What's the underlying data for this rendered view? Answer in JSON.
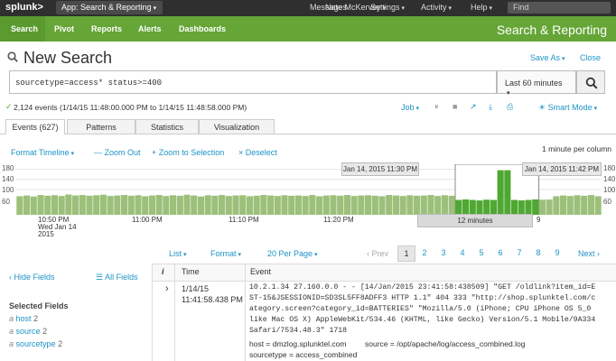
{
  "topbar": {
    "logo": "splunk>",
    "app": "App: Search & Reporting",
    "user": "Nate McKervey",
    "messages": "Messages",
    "settings": "Settings",
    "activity": "Activity",
    "help": "Help",
    "find": "Find"
  },
  "nav": {
    "items": [
      "Search",
      "Pivot",
      "Reports",
      "Alerts",
      "Dashboards"
    ],
    "app_title": "Search & Reporting"
  },
  "search": {
    "title": "New Search",
    "save_as": "Save As",
    "close": "Close",
    "query": "sourcetype=access* status>=400",
    "time_range": "Last 60 minutes"
  },
  "status": {
    "summary": "2,124 events (1/14/15 11:48:00.000 PM to 1/14/15 11:48:58.000 PM)",
    "job": "Job",
    "mode": "Smart Mode"
  },
  "tabs": [
    "Events (627)",
    "Patterns",
    "Statistics",
    "Visualization"
  ],
  "timeline": {
    "format": "Format Timeline",
    "zoom_out": "Zoom Out",
    "zoom_selection": "Zoom to Selection",
    "deselect": "Deselect",
    "scale": "1 minute per column",
    "y_ticks": [
      "180",
      "140",
      "100",
      "60"
    ],
    "y_ticks_right": [
      "180",
      "140",
      "100",
      "60"
    ],
    "tooltip_left": "Jan 14, 2015 11:30 PM",
    "tooltip_right": "Jan 14, 2015 11:42 PM",
    "selection": "12 minutes",
    "x_labels": [
      "10:50 PM",
      "11:00 PM",
      "11:10 PM",
      "11:20 PM"
    ],
    "x_sublabel": [
      "Wed Jan 14",
      "2015"
    ]
  },
  "chart_data": {
    "type": "bar",
    "values": [
      75,
      78,
      74,
      80,
      77,
      79,
      76,
      82,
      78,
      80,
      77,
      79,
      81,
      76,
      78,
      80,
      77,
      79,
      75,
      78,
      80,
      76,
      79,
      77,
      81,
      78,
      74,
      79,
      77,
      80,
      76,
      78,
      79,
      75,
      77,
      80,
      78,
      76,
      79,
      77,
      78,
      76,
      80,
      75,
      78,
      79,
      77,
      80,
      76,
      78,
      79,
      77,
      75,
      80,
      78,
      76,
      79,
      77,
      78,
      80,
      76,
      79,
      77,
      60,
      62,
      60,
      58,
      61,
      60,
      180,
      180,
      60,
      58,
      60,
      62,
      60,
      61,
      75,
      78,
      76,
      79,
      77,
      80,
      75
    ],
    "selected_range": [
      63,
      75
    ],
    "ylim": [
      0,
      200
    ]
  },
  "list_controls": {
    "list": "List",
    "format": "Format",
    "per_page": "20 Per Page",
    "prev": "‹ Prev",
    "pages": [
      "1",
      "2",
      "3",
      "4",
      "5",
      "6",
      "7",
      "8",
      "9"
    ],
    "next": "Next ›"
  },
  "fields": {
    "hide": "Hide Fields",
    "all": "All Fields",
    "selected_header": "Selected Fields",
    "items": [
      {
        "prefix": "a",
        "name": "host",
        "count": "2"
      },
      {
        "prefix": "a",
        "name": "source",
        "count": "2"
      },
      {
        "prefix": "a",
        "name": "sourcetype",
        "count": "2"
      }
    ]
  },
  "table": {
    "col_i": "i",
    "col_time": "Time",
    "col_event": "Event",
    "row": {
      "expand": "›",
      "date": "1/14/15",
      "time": "11:41:58.438 PM",
      "event_lines": [
        "10.2.1.34 27.160.0.0 - - [14/Jan/2015 23:41:58:438509] \"GET /oldlink?item_id=E",
        "ST-15&JSESSIONID=SD3SL5FF8ADFF3 HTTP 1.1\" 404 333 \"http://shop.splunktel.com/c",
        "ategory.screen?category_id=BATTERIES\" \"Mozilla/5.0 (iPhone; CPU iPhone OS 5_0",
        " like Mac OS X) AppleWebKit/534.46 (KHTML, like Gecko) Version/5.1 Mobile/9A334",
        " Safari/7534.48.3\" 1718"
      ],
      "host_label": "host = dmzlog.splunktel.com",
      "source_label": "source = /opt/apache/log/access_combined.log",
      "sourcetype_label": "sourcetype = access_combined"
    }
  },
  "colors": {
    "topbar": "#2f2f2f",
    "green": "#65a637",
    "link": "#1e93c6",
    "bar": "#9cc07a",
    "bar_selected": "#4fa832"
  }
}
